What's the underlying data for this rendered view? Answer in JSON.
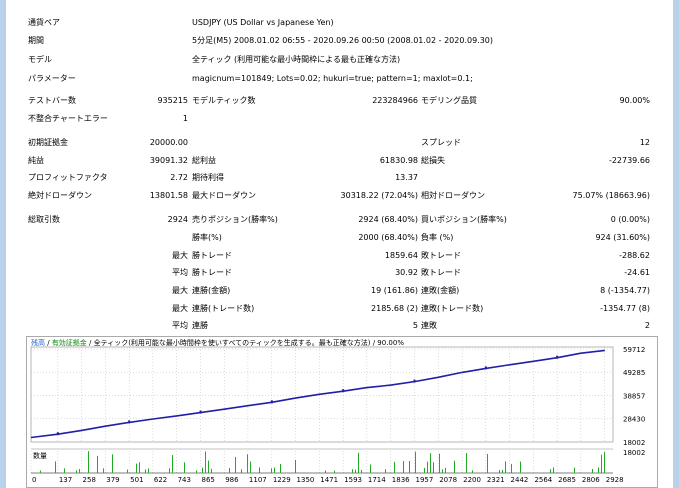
{
  "info": {
    "symbol_label": "通貨ペア",
    "symbol": "USDJPY (US Dollar vs Japanese Yen)",
    "period_label": "期間",
    "period": "5分足(M5) 2008.01.02 06:55 - 2020.09.26 00:50 (2008.01.02 - 2020.09.30)",
    "model_label": "モデル",
    "model": "全ティック (利用可能な最小時間枠による最も正確な方法)",
    "params_label": "パラメーター",
    "params": "magicnum=101849; Lots=0.02; hukuri=true; pattern=1; maxlot=0.1;"
  },
  "stats": {
    "bars_label": "テストバー数",
    "bars": "935215",
    "ticks_label": "モデルティック数",
    "ticks": "223284966",
    "quality_label": "モデリング品質",
    "quality": "90.00%",
    "errors_label": "不整合チャートエラー",
    "errors": "1",
    "initial_label": "初期証拠金",
    "initial": "20000.00",
    "spread_label": "スプレッド",
    "spread": "12",
    "net_label": "純益",
    "net": "39091.32",
    "gross_profit_label": "総利益",
    "gross_profit": "61830.98",
    "gross_loss_label": "総損失",
    "gross_loss": "-22739.66",
    "pf_label": "プロフィットファクタ",
    "pf": "2.72",
    "payoff_label": "期待利得",
    "payoff": "13.37",
    "abs_dd_label": "絶対ドローダウン",
    "abs_dd": "13801.58",
    "max_dd_label": "最大ドローダウン",
    "max_dd": "30318.22 (72.04%)",
    "rel_dd_label": "相対ドローダウン",
    "rel_dd": "75.07% (18663.96)",
    "trades_label": "総取引数",
    "trades": "2924",
    "short_label": "売りポジション(勝率%)",
    "short": "2924 (68.40%)",
    "long_label": "買いポジション(勝率%)",
    "long": "0 (0.00%)",
    "win_label": "勝率(%)",
    "win": "2000 (68.40%)",
    "loss_label": "負率 (%)",
    "loss": "924 (31.60%)",
    "max_label": "最大",
    "avg_label": "平均",
    "largest_win_label": "勝トレード",
    "largest_win": "1859.64",
    "largest_loss_label": "敗トレード",
    "largest_loss": "-288.62",
    "avg_win_label": "勝トレード",
    "avg_win": "30.92",
    "avg_loss_label": "敗トレード",
    "avg_loss": "-24.61",
    "cons_win_money_label": "連勝(金額)",
    "cons_win_money": "19 (161.86)",
    "cons_loss_money_label": "連敗(金額)",
    "cons_loss_money": "8 (-1354.77)",
    "cons_win_trades_label": "連勝(トレード数)",
    "cons_win_trades": "2185.68 (2)",
    "cons_loss_trades_label": "連敗(トレード数)",
    "cons_loss_trades": "-1354.77 (8)",
    "avg_cons_win_label": "連勝",
    "avg_cons_win": "5",
    "avg_cons_loss_label": "連敗",
    "avg_cons_loss": "2"
  },
  "chart": {
    "header_balance": "残高",
    "header_sep1": " / ",
    "header_equity": "有効証拠金",
    "header_rest": " / 全ティック(利用可能な最小時間枠を使いすべてのティックを生成する。最も正確な方法) / 90.00%",
    "volume_label": "数量",
    "y_ticks": [
      "59712",
      "49285",
      "38857",
      "28430",
      "18002"
    ],
    "x_ticks": [
      "0",
      "137",
      "258",
      "379",
      "501",
      "622",
      "743",
      "865",
      "986",
      "1107",
      "1229",
      "1350",
      "1471",
      "1593",
      "1714",
      "1836",
      "1957",
      "2078",
      "2200",
      "2321",
      "2442",
      "2564",
      "2685",
      "2806",
      "2928"
    ],
    "colors": {
      "balance": "#1f1fa8",
      "grid": "#b8b8b8",
      "volume": "#22aa22"
    }
  },
  "chart_data": {
    "type": "line",
    "series": [
      {
        "x": [
          0,
          137,
          258,
          379,
          501,
          622,
          743,
          865,
          986,
          1107,
          1229,
          1350,
          1471,
          1593,
          1714,
          1836,
          1957,
          2078,
          2200,
          2321,
          2442,
          2564,
          2685,
          2806,
          2928
        ],
        "values": [
          20000,
          21500,
          23200,
          25100,
          26800,
          28300,
          29700,
          31200,
          32700,
          34300,
          35800,
          37700,
          39400,
          40800,
          42400,
          43500,
          45100,
          47000,
          49200,
          51000,
          52600,
          54200,
          55800,
          57800,
          59090
        ]
      }
    ],
    "y_ticks": [
      59712,
      49285,
      38857,
      28430,
      18002
    ],
    "ylim": [
      18002,
      60600
    ],
    "xlim": [
      0,
      2970
    ]
  }
}
